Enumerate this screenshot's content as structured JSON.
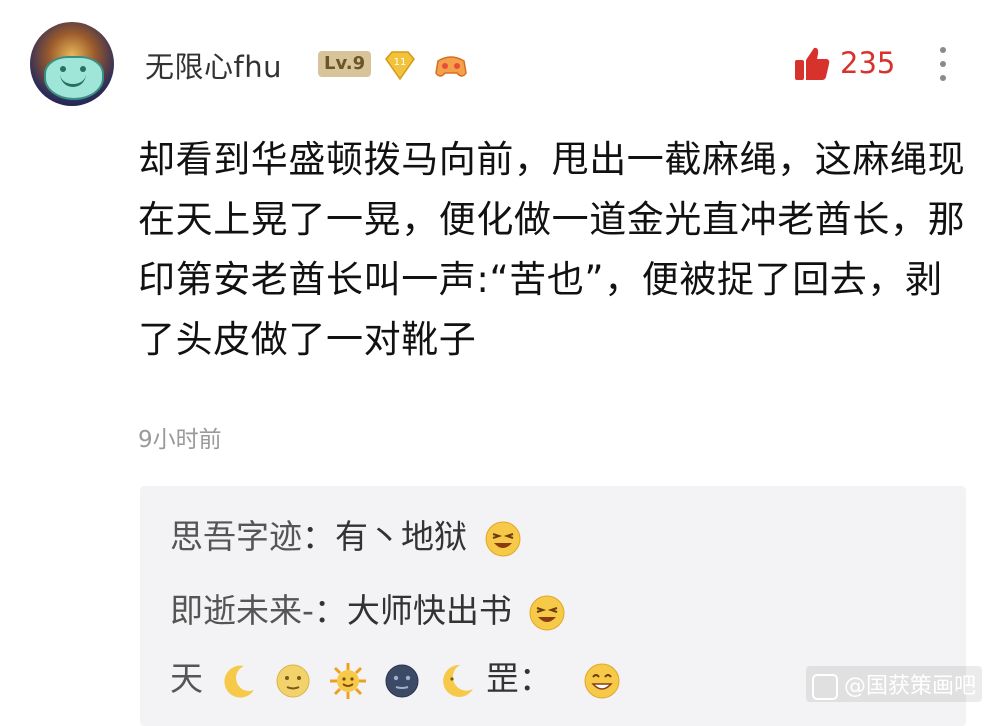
{
  "comment": {
    "username": "无限心fhu",
    "level": "Lv.9",
    "gem_level": "11",
    "like_count": "235",
    "text": "却看到华盛顿拨马向前，甩出一截麻绳，这麻绳现在天上晃了一晃，便化做一道金光直冲老酋长，那印第安老酋长叫一声:“苦也”，便被捉了回去，剥了头皮做了一对靴子",
    "time": "9小时前"
  },
  "replies": [
    {
      "name": "思吾字迹",
      "sep": "：",
      "text": "有丶地狱"
    },
    {
      "name": "即逝未来-",
      "sep": "：",
      "text": "大师快出书"
    },
    {
      "name": "天",
      "sep": "：",
      "text": "罡"
    }
  ],
  "watermark": "@国获策画吧",
  "colors": {
    "like": "#d8322d",
    "reply_bg": "#f3f3f5",
    "level_badge": "#d7c49a"
  }
}
